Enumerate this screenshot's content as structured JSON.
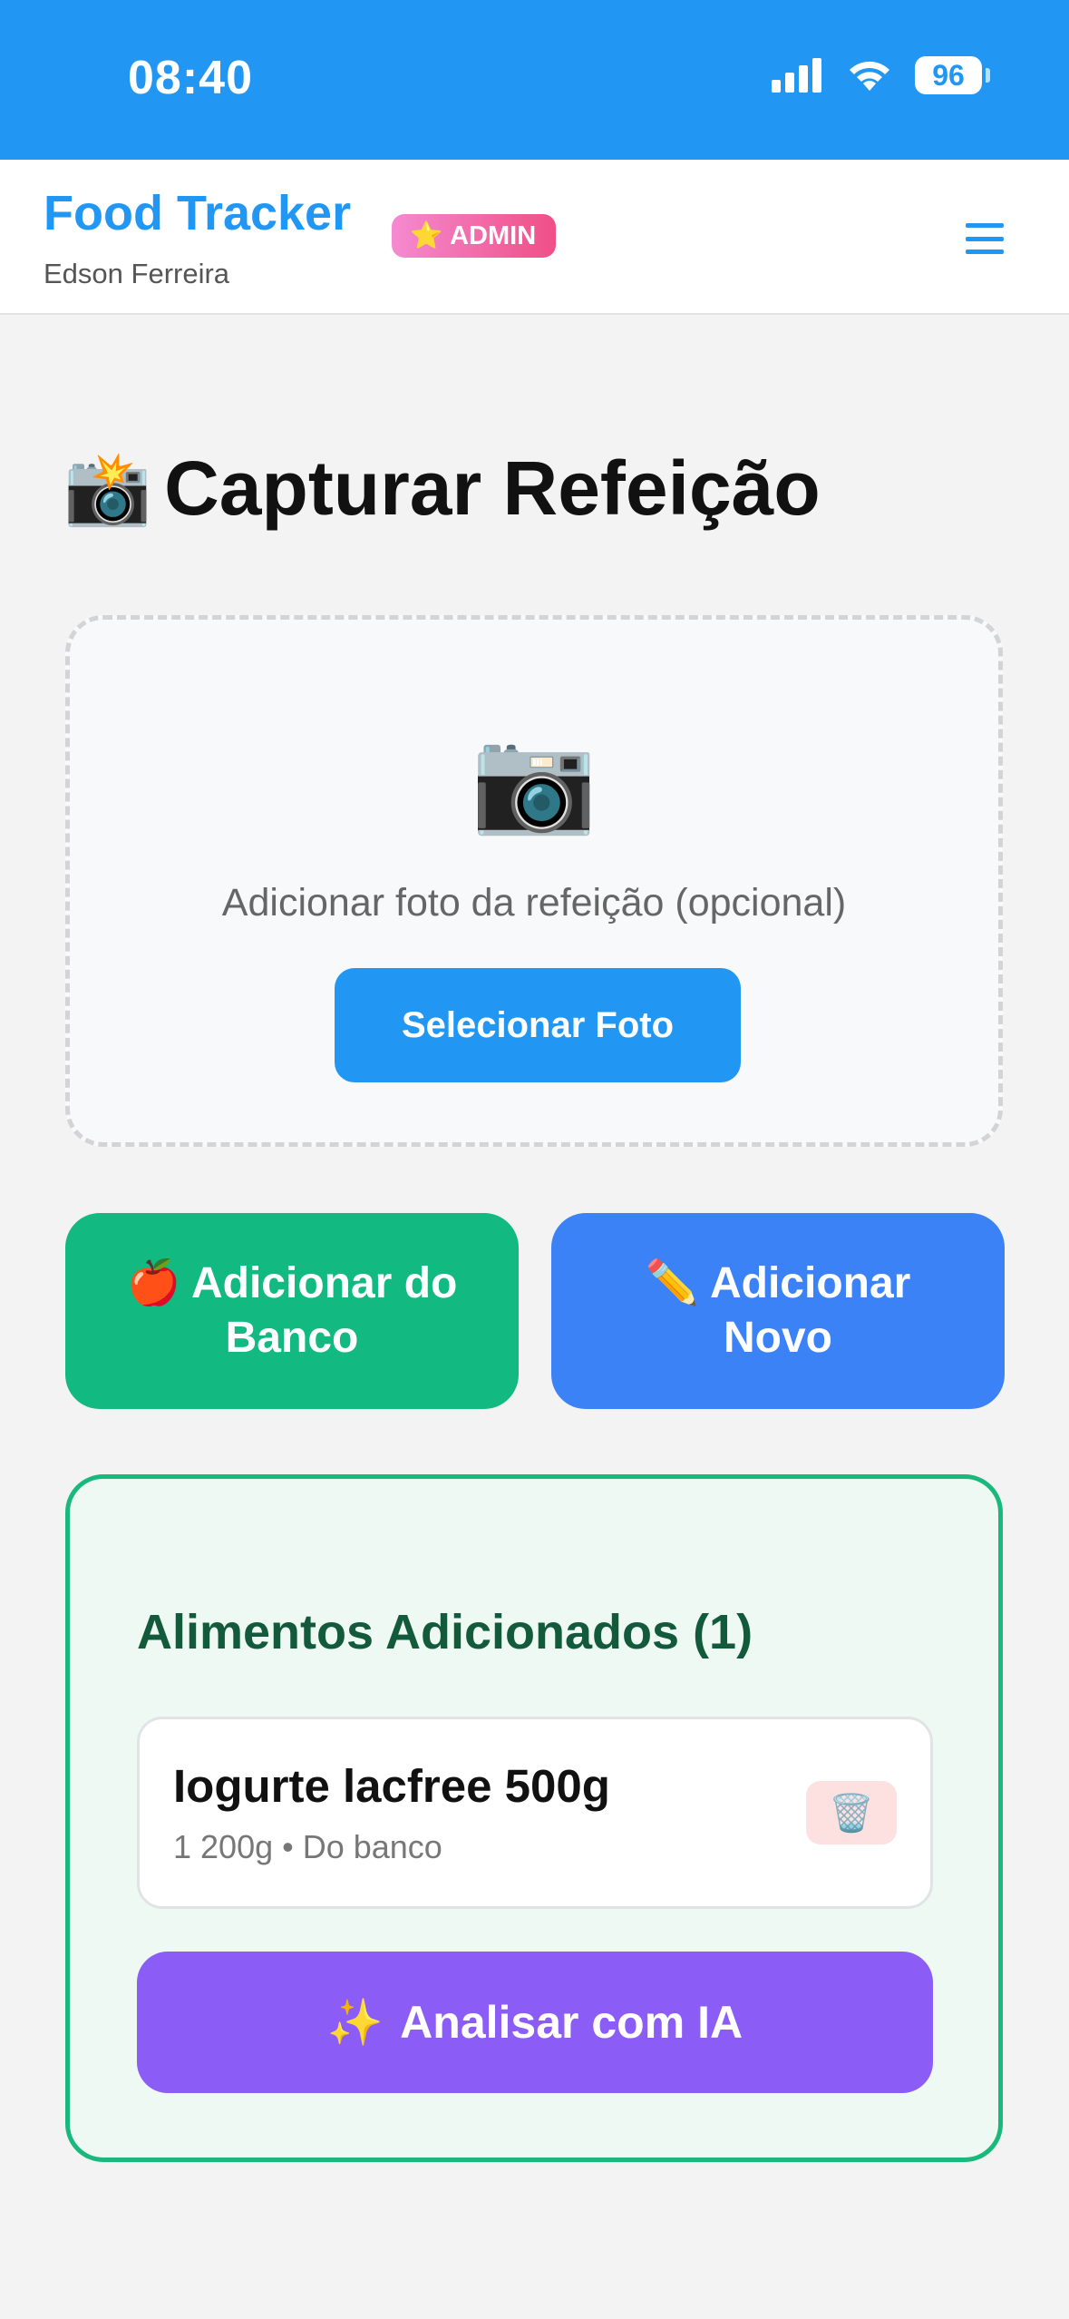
{
  "status_bar": {
    "time": "08:40",
    "battery": "96",
    "signal_icon": "signal-bars-icon",
    "wifi_icon": "wifi-icon"
  },
  "header": {
    "title": "Food Tracker",
    "user_name": "Edson Ferreira",
    "badge": {
      "icon": "⭐",
      "label": "ADMIN"
    },
    "menu_icon": "hamburger-menu-icon"
  },
  "page": {
    "title_icon": "📸",
    "title": "Capturar Refeição"
  },
  "upload": {
    "camera_icon": "📷",
    "hint": "Adicionar foto da refeição (opcional)",
    "button_label": "Selecionar Foto"
  },
  "actions": {
    "from_db": {
      "icon": "🍎",
      "label": "Adicionar do Banco"
    },
    "new": {
      "icon": "✏️",
      "label": "Adicionar Novo"
    }
  },
  "added_foods": {
    "title": "Alimentos Adicionados (1)",
    "items": [
      {
        "name": "Iogurte lacfree 500g",
        "meta": "1 200g • Do banco",
        "delete_icon": "🗑️"
      }
    ],
    "analyze": {
      "icon": "✨",
      "label": "Analisar com IA"
    }
  },
  "colors": {
    "primary": "#2196f3",
    "green": "#12b981",
    "blue": "#3b82f6",
    "purple": "#8b5cf6",
    "admin_badge": "#ef4f86"
  }
}
